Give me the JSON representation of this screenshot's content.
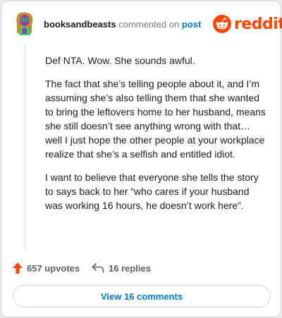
{
  "header": {
    "username": "booksandbeasts",
    "commented_on": "commented on",
    "post_link": "post",
    "logo_text": "reddit",
    "logo_icon": "reddit-snoo-icon",
    "avatar_icon": "avatar-icon"
  },
  "comment": {
    "paragraphs": [
      "Def NTA. Wow. She sounds awful.",
      "The fact that she’s telling people about it, and I’m assuming she’s also telling them that she wanted to bring the leftovers home to her husband, means she still doesn’t see anything wrong with that… well I just hope the other people at your workplace realize that she’s a selfish and entitled idiot.",
      "I want to believe that everyone she tells the story to says back to her “who cares if your husband was working 16 hours, he doesn’t work here”."
    ]
  },
  "footer": {
    "upvotes": "657 upvotes",
    "replies": "16 replies",
    "view_comments": "View 16 comments",
    "upvote_icon": "upvote-arrow-icon",
    "reply_icon": "reply-arrow-icon"
  },
  "colors": {
    "reddit_orange": "#ff4500",
    "link_blue": "#0079d3",
    "muted_gray": "#7c7c7c",
    "avatar_purple": "#8b3fa6",
    "avatar_green": "#2bd157"
  }
}
